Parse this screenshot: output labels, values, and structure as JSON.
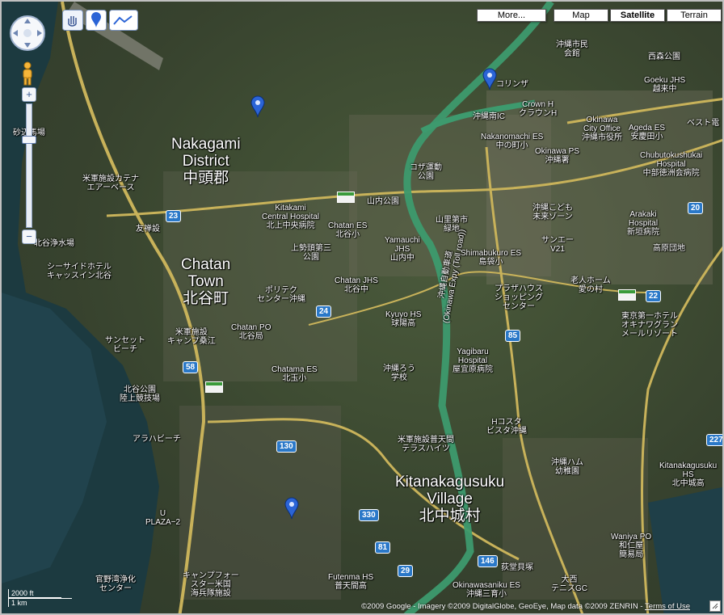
{
  "map_type_buttons": {
    "more": "More...",
    "map": "Map",
    "satellite": "Satellite",
    "terrain": "Terrain"
  },
  "tools": {
    "hand": "hand-icon",
    "pin": "pin-icon",
    "line": "line-icon"
  },
  "zoom": {
    "plus": "+",
    "minus": "−"
  },
  "districts": {
    "nakagami": {
      "en1": "Nakagami",
      "en2": "District",
      "jp": "中頭郡"
    },
    "chatan": {
      "en1": "Chatan",
      "en2": "Town",
      "jp": "北谷町"
    },
    "kitanakagusuku": {
      "en1": "Kitanakagusuku",
      "en2": "Village",
      "jp": "北中城村"
    }
  },
  "places": [
    "沖縄市民\n会館",
    "コリンザ",
    "西森公園",
    "Goeku JHS\n越来中",
    "Crown H\nクラウンH",
    "沖縄南IC",
    "Nakanomachi ES\n中の町小",
    "Okinawa\nCity Office\n沖縄市役所",
    "Ageda ES\n安慶田小",
    "Okinawa PS\n沖縄署",
    "Chubutokushukai\nHospital\n中部徳洲会病院",
    "ベスト電",
    "米軍施設カテナ\nエアーベース",
    "砂辺馬場",
    "コザ運動\n公園",
    "山内公園",
    "Kitakami\nCentral Hospital\n北上中央病院",
    "Chatan ES\n北谷小",
    "山里第市\n緑地",
    "沖縄こども\n未来ゾーン",
    "Arakaki\nHospital\n新垣病院",
    "友禅設",
    "上勢頭第三\n公園",
    "Yamauchi\nJHS\n山内中",
    "Shimabukuro ES\n島袋小",
    "サンエー\nV21",
    "高原団地",
    "北谷浄水場",
    "シーサイドホテル\nキャッスイン北谷",
    "ポリテク\nセンター沖縄",
    "Chatan JHS\n北谷中",
    "Kyuyo HS\n球陽高",
    "プラザハウス\nショッピング\nセンター",
    "老人ホーム\n愛の村",
    "東京第一ホテル\nオキナワグラン\nメールリゾート",
    "米軍施設\nキャンプ桑江",
    "Chatan PO\n北谷局",
    "サンセット\nビーチ",
    "Chatama ES\n北玉小",
    "沖縄ろう\n学校",
    "Yagibaru\nHospital\n屋宜原病院",
    "Hコスタ\nビスタ沖縄",
    "北谷公園\n陸上競技場",
    "アラハビーチ",
    "米軍施設普天間\nテラスハイツ",
    "沖縄ハム\n幼稚園",
    "Kitanakagusuku\nHS\n北中城高",
    "U\nPLAZA−2",
    "官野湾浄化\nセンター",
    "キャンプフォー\nスター米国\n海兵隊施設",
    "Futenma HS\n普天間高",
    "荻堂貝塚",
    "Okinawasaniku ES\n沖縄三育小",
    "大西\nテニスGC",
    "Waniya PO\n和仁屋\n簡易局",
    "沖縄自動車道\n(Okinawa Expy (Toll road))"
  ],
  "route_shields": [
    "23",
    "24",
    "58",
    "85",
    "130",
    "146",
    "330",
    "81",
    "29",
    "20",
    "22",
    "227"
  ],
  "scale": {
    "ft": "2000 ft",
    "km": "1 km"
  },
  "copyright": "©2009 Google - Imagery ©2009 DigitalGlobe, GeoEye, Map data ©2009 ZENRIN -",
  "terms": "Terms of Use",
  "colors": {
    "expressway": "#3d9a6e",
    "arterial": "#c8b25a",
    "marker": "#2b64d6",
    "shield": "#2a78c8"
  }
}
